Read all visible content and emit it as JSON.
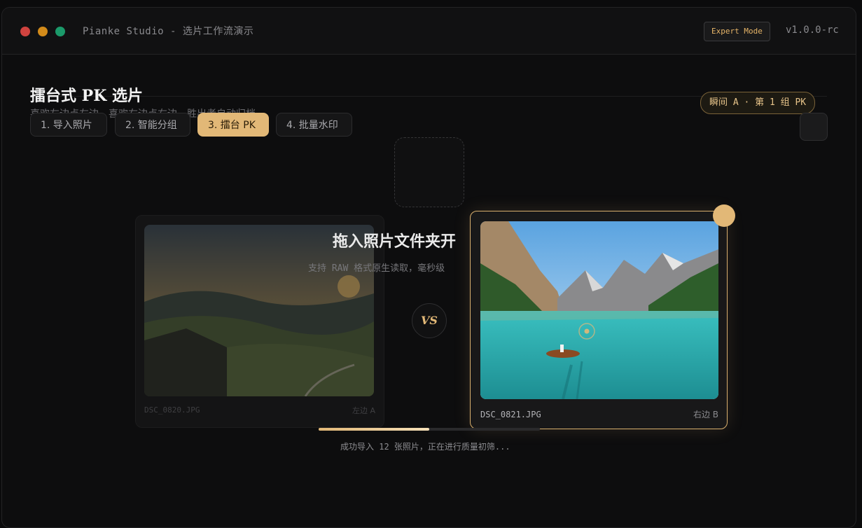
{
  "window": {
    "title": "Pianke Studio - 选片工作流演示",
    "mode_badge": "Expert Mode",
    "version": "v1.0.0-rc"
  },
  "page": {
    "title": "擂台式 PK 选片",
    "subtitle": "喜欢左边点左边，喜欢右边点右边，胜出者自动归档",
    "round_badge": "瞬间 A · 第 1 组 PK"
  },
  "steps": [
    {
      "label": "1. 导入照片",
      "active": false
    },
    {
      "label": "2. 智能分组",
      "active": false
    },
    {
      "label": "3. 擂台 PK",
      "active": true
    },
    {
      "label": "4. 批量水印",
      "active": false
    }
  ],
  "import": {
    "title": "拖入照片文件夹开",
    "subtitle": "支持 RAW 格式原生读取，毫秒级"
  },
  "pk": {
    "vs_label": "VS",
    "left": {
      "filename": "DSC_0820.JPG",
      "side": "左边 A"
    },
    "right": {
      "filename": "DSC_0821.JPG",
      "side": "右边 B"
    }
  },
  "progress": {
    "fraction": 0.5,
    "status": "成功导入 12 张照片，正在进行质量初筛..."
  },
  "colors": {
    "accent": "#e2b877",
    "background": "#0d0d0e"
  }
}
